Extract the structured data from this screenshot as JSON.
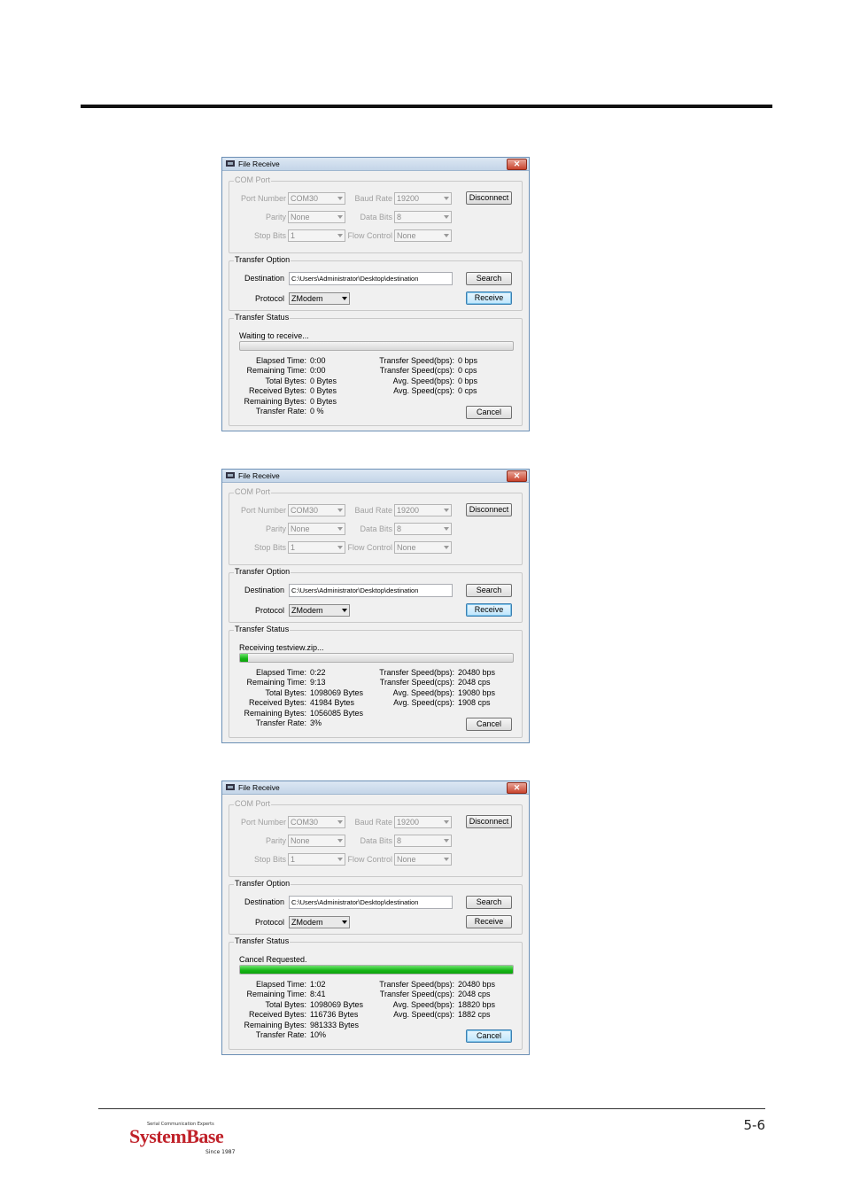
{
  "page": {
    "number": "5-6"
  },
  "logo": {
    "tagline": "Serial Communication Experts",
    "brand": "SystemBase",
    "since": "Since 1987"
  },
  "colors": {
    "brand_red": "#c0222a",
    "progress_green": "#15b515",
    "title_bar": "#c4d5e8"
  },
  "labels": {
    "title": "File Receive",
    "com_port": "COM Port",
    "port_number": "Port Number",
    "baud_rate": "Baud Rate",
    "parity": "Parity",
    "data_bits": "Data Bits",
    "stop_bits": "Stop Bits",
    "flow_control": "Flow Control",
    "disconnect": "Disconnect",
    "transfer_option": "Transfer Option",
    "destination": "Destination",
    "protocol": "Protocol",
    "search": "Search",
    "receive": "Receive",
    "transfer_status": "Transfer Status",
    "cancel": "Cancel",
    "elapsed_time": "Elapsed Time:",
    "remaining_time": "Remaining Time:",
    "total_bytes": "Total Bytes:",
    "received_bytes": "Received Bytes:",
    "remaining_bytes": "Remaining Bytes:",
    "transfer_rate": "Transfer Rate:",
    "speed_bps": "Transfer Speed(bps):",
    "speed_cps": "Transfer Speed(cps):",
    "avg_bps": "Avg. Speed(bps):",
    "avg_cps": "Avg. Speed(cps):"
  },
  "com_values": {
    "port_number": "COM30",
    "baud_rate": "19200",
    "parity": "None",
    "data_bits": "8",
    "stop_bits": "1",
    "flow_control": "None"
  },
  "transfer_values": {
    "destination": "C:\\Users\\Administrator\\Desktop\\destination",
    "protocol": "ZModem"
  },
  "windows": [
    {
      "status": "Waiting to receive...",
      "progress": 0,
      "elapsed_time": "0:00",
      "remaining_time": "0:00",
      "total_bytes": "0 Bytes",
      "received_bytes": "0 Bytes",
      "remaining_bytes": "0 Bytes",
      "transfer_rate": "0 %",
      "speed_bps": "0 bps",
      "speed_cps": "0 cps",
      "avg_bps": "0 bps",
      "avg_cps": "0 cps"
    },
    {
      "status": "Receiving testview.zip...",
      "progress": 3,
      "elapsed_time": "0:22",
      "remaining_time": "9:13",
      "total_bytes": "1098069 Bytes",
      "received_bytes": "41984 Bytes",
      "remaining_bytes": "1056085 Bytes",
      "transfer_rate": "3%",
      "speed_bps": "20480 bps",
      "speed_cps": "2048 cps",
      "avg_bps": "19080 bps",
      "avg_cps": "1908 cps"
    },
    {
      "status": "Cancel Requested.",
      "progress": 100,
      "elapsed_time": "1:02",
      "remaining_time": "8:41",
      "total_bytes": "1098069 Bytes",
      "received_bytes": "116736 Bytes",
      "remaining_bytes": "981333 Bytes",
      "transfer_rate": "10%",
      "speed_bps": "20480 bps",
      "speed_cps": "2048 cps",
      "avg_bps": "18820 bps",
      "avg_cps": "1882 cps"
    }
  ]
}
